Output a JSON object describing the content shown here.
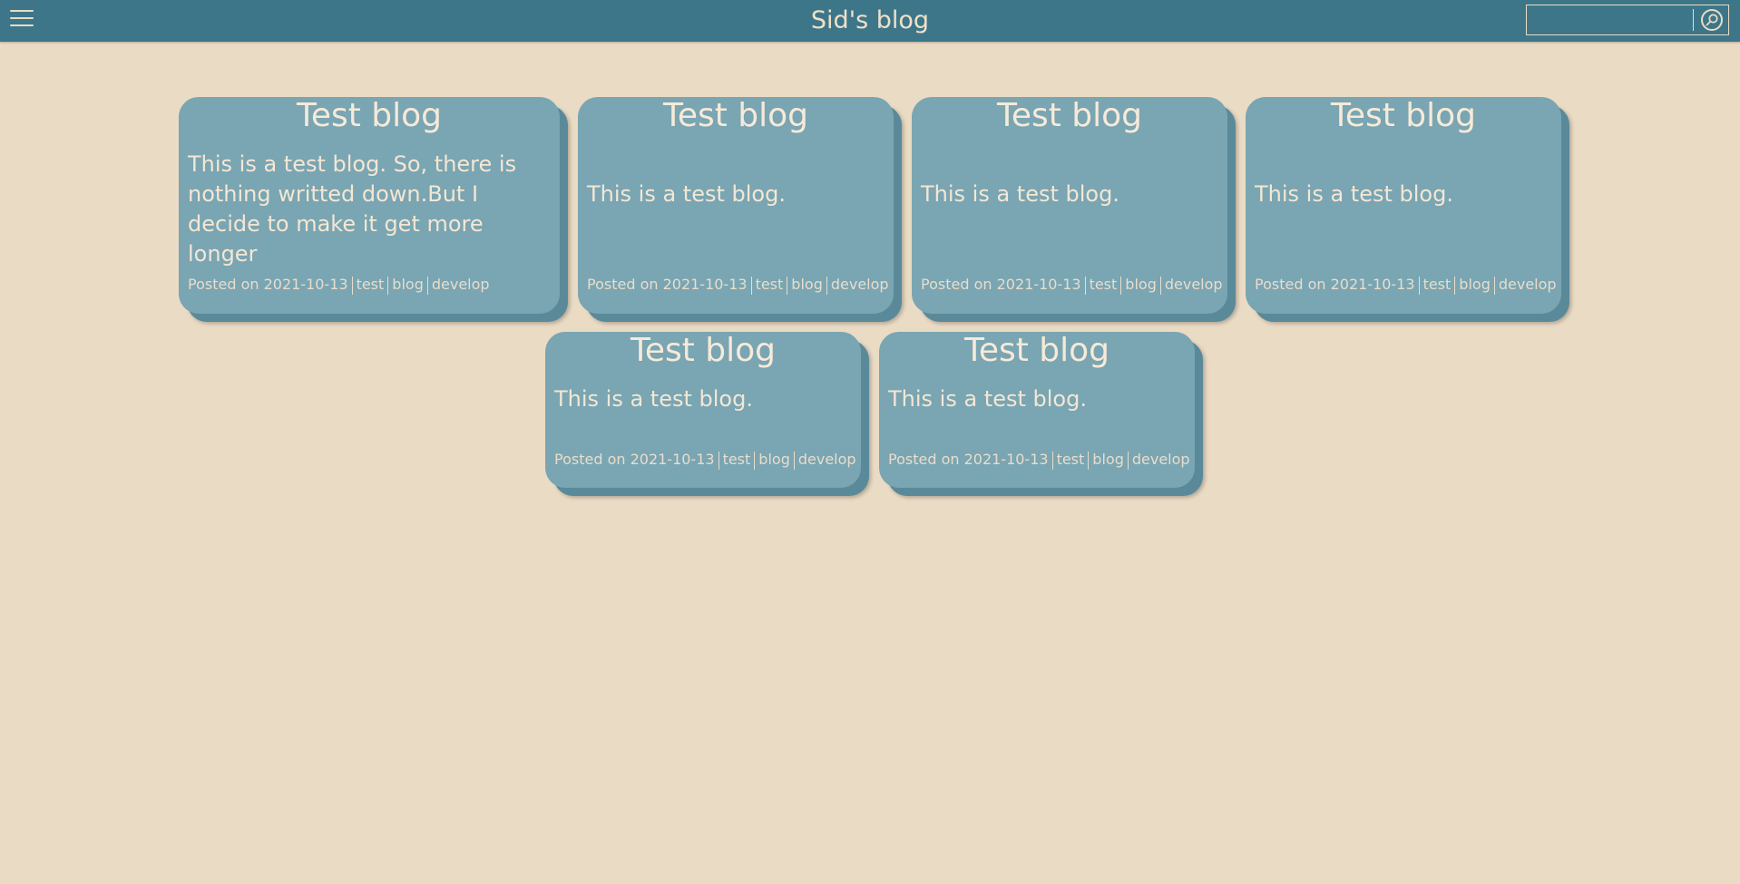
{
  "header": {
    "title": "Sid's blog",
    "search_placeholder": ""
  },
  "posts": [
    {
      "title": "Test blog",
      "excerpt": "This is a test blog. So, there is nothing writted down.But I decide to make it get more longer",
      "posted_label": "Posted on 2021-10-13",
      "tags": [
        "test",
        "blog",
        "develop"
      ]
    },
    {
      "title": "Test blog",
      "excerpt": "This is a test blog.",
      "posted_label": "Posted on 2021-10-13",
      "tags": [
        "test",
        "blog",
        "develop"
      ]
    },
    {
      "title": "Test blog",
      "excerpt": "This is a test blog.",
      "posted_label": "Posted on 2021-10-13",
      "tags": [
        "test",
        "blog",
        "develop"
      ]
    },
    {
      "title": "Test blog",
      "excerpt": "This is a test blog.",
      "posted_label": "Posted on 2021-10-13",
      "tags": [
        "test",
        "blog",
        "develop"
      ]
    },
    {
      "title": "Test blog",
      "excerpt": "This is a test blog.",
      "posted_label": "Posted on 2021-10-13",
      "tags": [
        "test",
        "blog",
        "develop"
      ]
    },
    {
      "title": "Test blog",
      "excerpt": "This is a test blog.",
      "posted_label": "Posted on 2021-10-13",
      "tags": [
        "test",
        "blog",
        "develop"
      ]
    }
  ]
}
